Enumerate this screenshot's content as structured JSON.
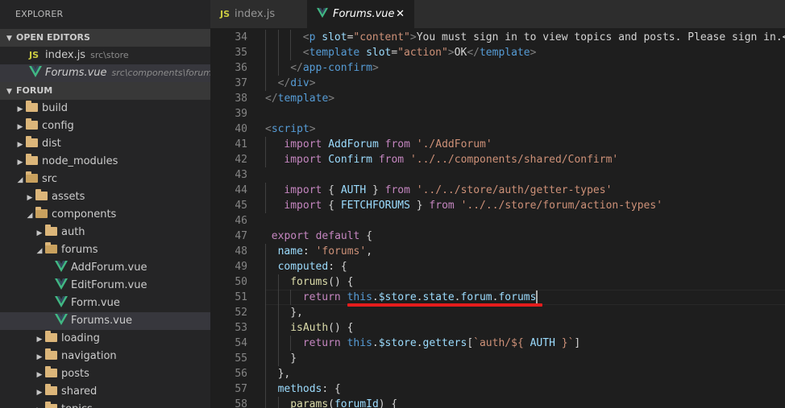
{
  "sidebar": {
    "title": "EXPLORER",
    "open_editors_label": "OPEN EDITORS",
    "open_editors": [
      {
        "name": "index.js",
        "desc": "src\\store",
        "type": "js"
      },
      {
        "name": "Forums.vue",
        "desc": "src\\components\\forums",
        "type": "vue"
      }
    ],
    "project_label": "FORUM",
    "tree": [
      {
        "label": "build",
        "depth": 0,
        "kind": "folder",
        "expanded": false
      },
      {
        "label": "config",
        "depth": 0,
        "kind": "folder",
        "expanded": false
      },
      {
        "label": "dist",
        "depth": 0,
        "kind": "folder",
        "expanded": false
      },
      {
        "label": "node_modules",
        "depth": 0,
        "kind": "folder",
        "expanded": false
      },
      {
        "label": "src",
        "depth": 0,
        "kind": "folder",
        "expanded": true
      },
      {
        "label": "assets",
        "depth": 1,
        "kind": "folder",
        "expanded": false
      },
      {
        "label": "components",
        "depth": 1,
        "kind": "folder",
        "expanded": true
      },
      {
        "label": "auth",
        "depth": 2,
        "kind": "folder",
        "expanded": false
      },
      {
        "label": "forums",
        "depth": 2,
        "kind": "folder",
        "expanded": true
      },
      {
        "label": "AddForum.vue",
        "depth": 3,
        "kind": "vue"
      },
      {
        "label": "EditForum.vue",
        "depth": 3,
        "kind": "vue"
      },
      {
        "label": "Form.vue",
        "depth": 3,
        "kind": "vue"
      },
      {
        "label": "Forums.vue",
        "depth": 3,
        "kind": "vue",
        "selected": true
      },
      {
        "label": "loading",
        "depth": 2,
        "kind": "folder",
        "expanded": false
      },
      {
        "label": "navigation",
        "depth": 2,
        "kind": "folder",
        "expanded": false
      },
      {
        "label": "posts",
        "depth": 2,
        "kind": "folder",
        "expanded": false
      },
      {
        "label": "shared",
        "depth": 2,
        "kind": "folder",
        "expanded": false
      },
      {
        "label": "topics",
        "depth": 2,
        "kind": "folder",
        "expanded": false
      }
    ]
  },
  "tabs": [
    {
      "label": "index.js",
      "icon": "js-icon",
      "active": false
    },
    {
      "label": "Forums.vue",
      "icon": "vue-icon",
      "active": true,
      "close": "✕"
    }
  ],
  "editor": {
    "lines": [
      {
        "n": "34",
        "indent": 3,
        "tokens": [
          [
            "t-bracket",
            "<"
          ],
          [
            "t-tag",
            "p"
          ],
          [
            "t-text",
            " "
          ],
          [
            "t-attr",
            "slot"
          ],
          [
            "t-text",
            "="
          ],
          [
            "t-str",
            "\"content\""
          ],
          [
            "t-bracket",
            ">"
          ],
          [
            "t-text",
            "You must sign in to view topics and posts. Please sign in.</"
          ]
        ]
      },
      {
        "n": "35",
        "indent": 3,
        "tokens": [
          [
            "t-bracket",
            "<"
          ],
          [
            "t-tag",
            "template"
          ],
          [
            "t-text",
            " "
          ],
          [
            "t-attr",
            "slot"
          ],
          [
            "t-text",
            "="
          ],
          [
            "t-str",
            "\"action\""
          ],
          [
            "t-bracket",
            ">"
          ],
          [
            "t-text",
            "OK"
          ],
          [
            "t-bracket",
            "</"
          ],
          [
            "t-tag",
            "template"
          ],
          [
            "t-bracket",
            ">"
          ]
        ]
      },
      {
        "n": "36",
        "indent": 2,
        "tokens": [
          [
            "t-bracket",
            "</"
          ],
          [
            "t-tag",
            "app-confirm"
          ],
          [
            "t-bracket",
            ">"
          ]
        ]
      },
      {
        "n": "37",
        "indent": 1,
        "tokens": [
          [
            "t-bracket",
            "</"
          ],
          [
            "t-tag",
            "div"
          ],
          [
            "t-bracket",
            ">"
          ]
        ]
      },
      {
        "n": "38",
        "indent": 0,
        "tokens": [
          [
            "t-bracket",
            "</"
          ],
          [
            "t-tag",
            "template"
          ],
          [
            "t-bracket",
            ">"
          ]
        ]
      },
      {
        "n": "39",
        "indent": 0,
        "tokens": []
      },
      {
        "n": "40",
        "indent": 0,
        "tokens": [
          [
            "t-bracket",
            "<"
          ],
          [
            "t-tag",
            "script"
          ],
          [
            "t-bracket",
            ">"
          ]
        ]
      },
      {
        "n": "41",
        "indent": 1.5,
        "tokens": [
          [
            "t-kw",
            "import"
          ],
          [
            "t-text",
            " "
          ],
          [
            "t-id",
            "AddForum"
          ],
          [
            "t-text",
            " "
          ],
          [
            "t-kw",
            "from"
          ],
          [
            "t-text",
            " "
          ],
          [
            "t-str",
            "'./AddForum'"
          ]
        ]
      },
      {
        "n": "42",
        "indent": 1.5,
        "tokens": [
          [
            "t-kw",
            "import"
          ],
          [
            "t-text",
            " "
          ],
          [
            "t-id",
            "Confirm"
          ],
          [
            "t-text",
            " "
          ],
          [
            "t-kw",
            "from"
          ],
          [
            "t-text",
            " "
          ],
          [
            "t-str",
            "'../../components/shared/Confirm'"
          ]
        ]
      },
      {
        "n": "43",
        "indent": 0,
        "tokens": []
      },
      {
        "n": "44",
        "indent": 1.5,
        "tokens": [
          [
            "t-kw",
            "import"
          ],
          [
            "t-punct",
            " { "
          ],
          [
            "t-id",
            "AUTH"
          ],
          [
            "t-punct",
            " } "
          ],
          [
            "t-kw",
            "from"
          ],
          [
            "t-text",
            " "
          ],
          [
            "t-str",
            "'../../store/auth/getter-types'"
          ]
        ]
      },
      {
        "n": "45",
        "indent": 1.5,
        "tokens": [
          [
            "t-kw",
            "import"
          ],
          [
            "t-punct",
            " { "
          ],
          [
            "t-id",
            "FETCHFORUMS"
          ],
          [
            "t-punct",
            " } "
          ],
          [
            "t-kw",
            "from"
          ],
          [
            "t-text",
            " "
          ],
          [
            "t-str",
            "'../../store/forum/action-types'"
          ]
        ]
      },
      {
        "n": "46",
        "indent": 0,
        "tokens": []
      },
      {
        "n": "47",
        "indent": 0.5,
        "tokens": [
          [
            "t-kw",
            "export"
          ],
          [
            "t-text",
            " "
          ],
          [
            "t-kw",
            "default"
          ],
          [
            "t-punct",
            " {"
          ]
        ]
      },
      {
        "n": "48",
        "indent": 1,
        "tokens": [
          [
            "t-id",
            "name"
          ],
          [
            "t-punct",
            ": "
          ],
          [
            "t-str",
            "'forums'"
          ],
          [
            "t-punct",
            ","
          ]
        ]
      },
      {
        "n": "49",
        "indent": 1,
        "tokens": [
          [
            "t-id",
            "computed"
          ],
          [
            "t-punct",
            ": {"
          ]
        ]
      },
      {
        "n": "50",
        "indent": 2,
        "tokens": [
          [
            "t-fn",
            "forums"
          ],
          [
            "t-punct",
            "() {"
          ]
        ]
      },
      {
        "n": "51",
        "indent": 3,
        "tokens": [
          [
            "t-kw",
            "return"
          ],
          [
            "t-text",
            " "
          ],
          [
            "t-kw2",
            "this"
          ],
          [
            "t-punct",
            "."
          ],
          [
            "t-id",
            "$store"
          ],
          [
            "t-punct",
            "."
          ],
          [
            "t-id",
            "state"
          ],
          [
            "t-punct",
            "."
          ],
          [
            "t-id",
            "forum"
          ],
          [
            "t-punct",
            "."
          ],
          [
            "t-id",
            "forums"
          ]
        ]
      },
      {
        "n": "52",
        "indent": 2,
        "tokens": [
          [
            "t-punct",
            "},"
          ]
        ]
      },
      {
        "n": "53",
        "indent": 2,
        "tokens": [
          [
            "t-fn",
            "isAuth"
          ],
          [
            "t-punct",
            "() {"
          ]
        ]
      },
      {
        "n": "54",
        "indent": 3,
        "tokens": [
          [
            "t-kw",
            "return"
          ],
          [
            "t-text",
            " "
          ],
          [
            "t-kw2",
            "this"
          ],
          [
            "t-punct",
            "."
          ],
          [
            "t-id",
            "$store"
          ],
          [
            "t-punct",
            "."
          ],
          [
            "t-id",
            "getters"
          ],
          [
            "t-punct",
            "["
          ],
          [
            "t-str",
            "`auth/${ "
          ],
          [
            "t-id",
            "AUTH"
          ],
          [
            "t-str",
            " }`"
          ],
          [
            "t-punct",
            "]"
          ]
        ]
      },
      {
        "n": "55",
        "indent": 2,
        "tokens": [
          [
            "t-punct",
            "}"
          ]
        ]
      },
      {
        "n": "56",
        "indent": 1,
        "tokens": [
          [
            "t-punct",
            "},"
          ]
        ]
      },
      {
        "n": "57",
        "indent": 1,
        "tokens": [
          [
            "t-id",
            "methods"
          ],
          [
            "t-punct",
            ": {"
          ]
        ]
      },
      {
        "n": "58",
        "indent": 2,
        "tokens": [
          [
            "t-fn",
            "params"
          ],
          [
            "t-punct",
            "("
          ],
          [
            "t-id",
            "forumId"
          ],
          [
            "t-punct",
            ") {"
          ]
        ]
      }
    ]
  }
}
